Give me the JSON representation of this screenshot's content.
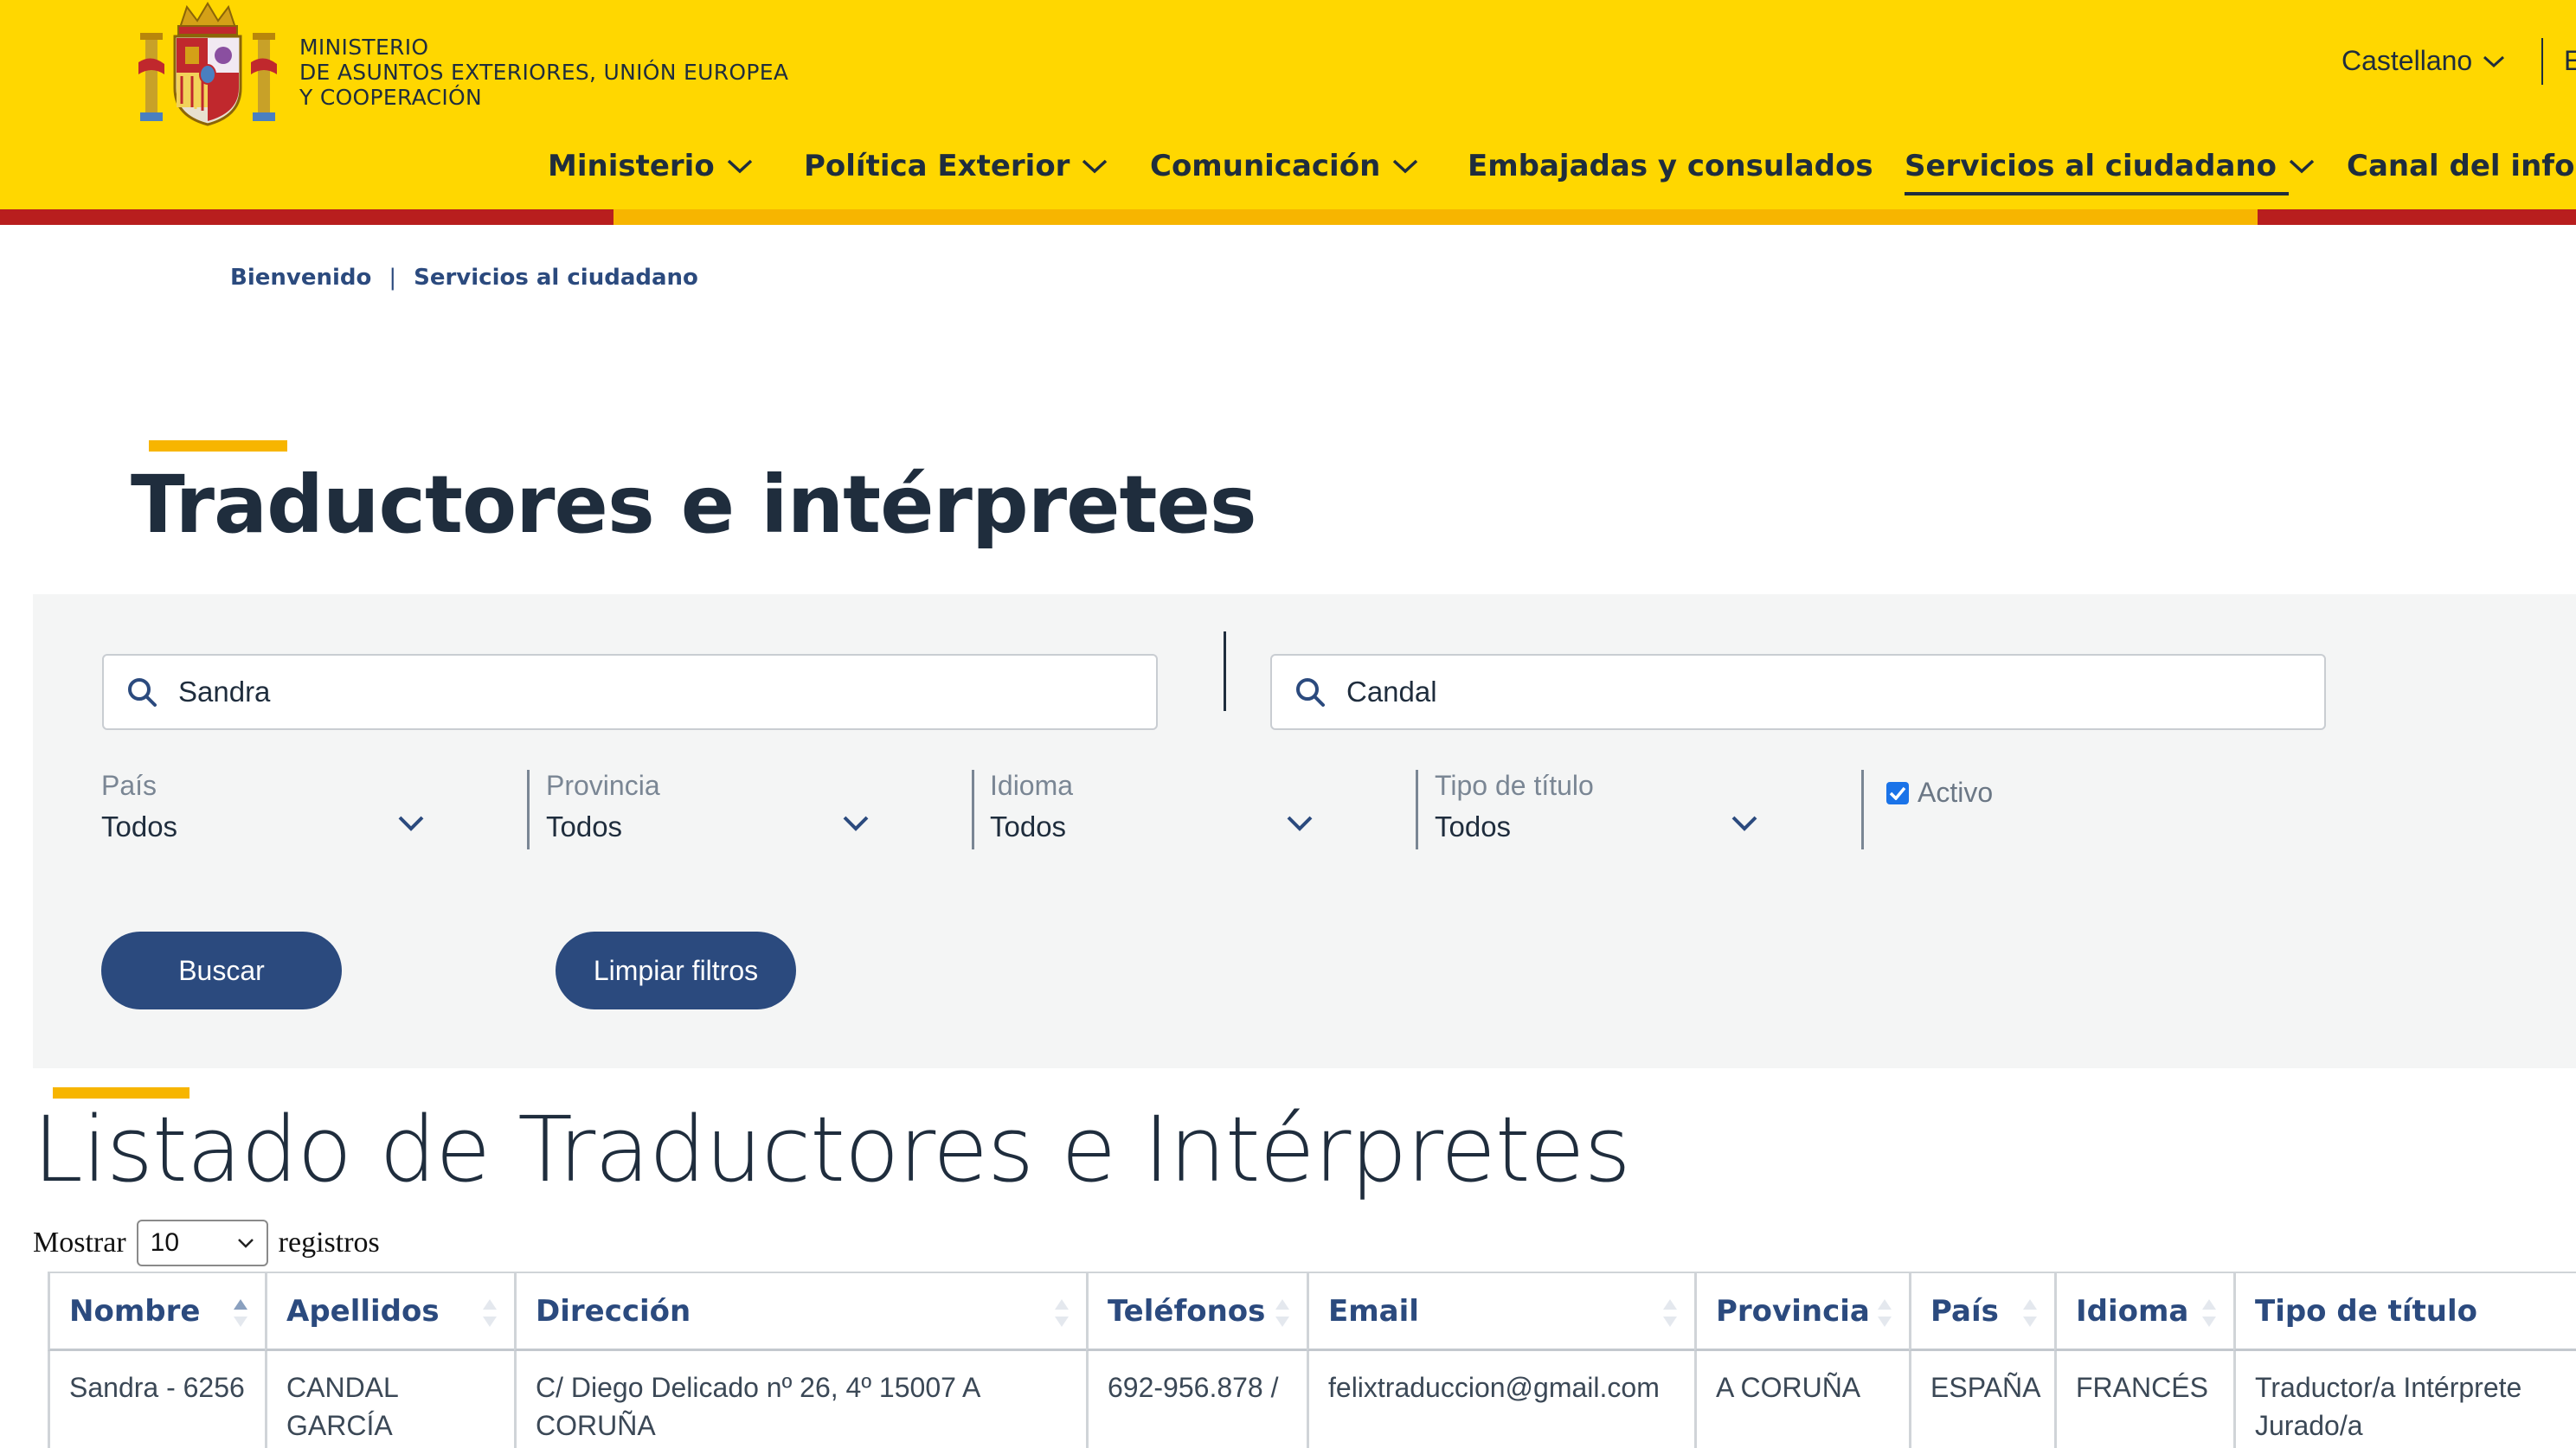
{
  "header": {
    "ministry_lines": [
      "MINISTERIO",
      "DE ASUNTOS EXTERIORES, UNIÓN EUROPEA",
      "Y COOPERACIÓN"
    ],
    "language": "Castellano",
    "language_next_partial": "E",
    "nav": [
      {
        "label": "Ministerio",
        "dropdown": true
      },
      {
        "label": "Política Exterior",
        "dropdown": true
      },
      {
        "label": "Comunicación",
        "dropdown": true
      },
      {
        "label": "Embajadas y consulados",
        "dropdown": false
      },
      {
        "label": "Servicios al ciudadano",
        "dropdown": true,
        "active": true
      },
      {
        "label": "Canal del infor",
        "dropdown": false
      }
    ],
    "colors": {
      "yellow": "#ffd700",
      "red": "#b81e1e",
      "accent": "#f7b500",
      "navy": "#2b4a7e"
    }
  },
  "breadcrumb": [
    "Bienvenido",
    "Servicios al ciudadano"
  ],
  "page_title": "Traductores e intérpretes",
  "search": {
    "nombre_value": "Sandra",
    "apellidos_value": "Candal",
    "icon": "search-icon"
  },
  "filters": [
    {
      "label": "País",
      "value": "Todos"
    },
    {
      "label": "Provincia",
      "value": "Todos"
    },
    {
      "label": "Idioma",
      "value": "Todos"
    },
    {
      "label": "Tipo de título",
      "value": "Todos"
    }
  ],
  "activo": {
    "label": "Activo",
    "checked": true
  },
  "buttons": {
    "buscar": "Buscar",
    "limpiar": "Limpiar filtros"
  },
  "listing": {
    "title": "Listado de Traductores e Intérpretes",
    "show_prefix": "Mostrar",
    "show_value": "10",
    "show_suffix": "registros"
  },
  "table": {
    "columns": [
      "Nombre",
      "Apellidos",
      "Dirección",
      "Teléfonos",
      "Email",
      "Provincia",
      "País",
      "Idioma",
      "Tipo de título"
    ],
    "rows": [
      [
        "Sandra - 6256",
        "CANDAL GARCÍA",
        "C/ Diego Delicado nº 26, 4º 15007 A CORUÑA",
        "692-956.878 /",
        "felixtraduccion@gmail.com",
        "A CORUÑA",
        "ESPAÑA",
        "FRANCÉS",
        "Traductor/a Intérprete Jurado/a"
      ]
    ]
  }
}
